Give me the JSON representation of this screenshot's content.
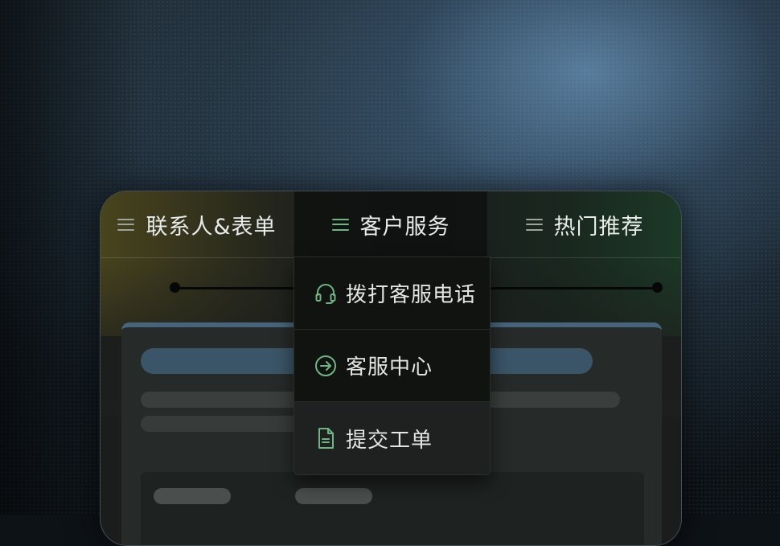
{
  "tabs": [
    {
      "label": "联系人&表单",
      "icon": "hamburger-icon",
      "active": false
    },
    {
      "label": "客户服务",
      "icon": "hamburger-icon",
      "active": true
    },
    {
      "label": "热门推荐",
      "icon": "hamburger-icon",
      "active": false
    }
  ],
  "dropdown": {
    "items": [
      {
        "label": "拨打客服电话",
        "icon": "headset-icon"
      },
      {
        "label": "客服中心",
        "icon": "arrow-circle-right-icon"
      },
      {
        "label": "提交工单",
        "icon": "document-icon"
      }
    ]
  },
  "colors": {
    "accent_green": "#6fb583",
    "skeleton_blue": "#3a5568",
    "menu_bg": "#111311"
  }
}
